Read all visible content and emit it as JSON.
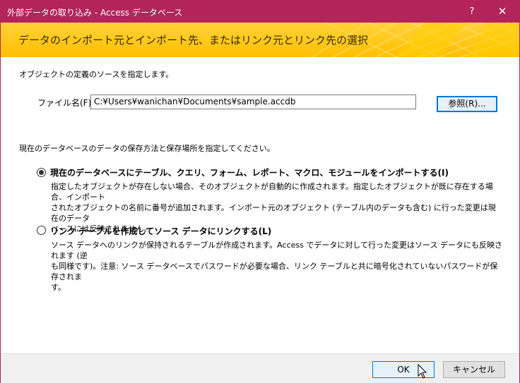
{
  "window": {
    "title": "外部データの取り込み - Access データベース",
    "help_label": "?",
    "close_label": "✕",
    "accent_color": "#b3245b"
  },
  "banner": {
    "heading": "データのインポート元とインポート先、またはリンク元とリンク先の選択",
    "color": "#ffc000"
  },
  "source": {
    "description": "オブジェクトの定義のソースを指定します。",
    "file_label": "ファイル名(F):",
    "file_value": "C:¥Users¥wanichan¥Documents¥sample.accdb",
    "browse_label": "参照(R)..."
  },
  "storage": {
    "description": "現在のデータベースのデータの保存方法と保存場所を指定してください。",
    "options": [
      {
        "label": "現在のデータベースにテーブル、クエリ、フォーム、レポート、マクロ、モジュールをインポートする(I)",
        "selected": true,
        "description_lines": [
          "指定したオブジェクトが存在しない場合、そのオブジェクトが自動的に作成されます。指定したオブジェクトが既に存在する場合、インポート",
          "されたオブジェクトの名前に番号が追加されます。インポート元のオブジェクト (テーブル内のデータも含む) に行った変更は現在のデータ",
          "ベースには反映されません。"
        ]
      },
      {
        "label": "リンク テーブルを作成してソース データにリンクする(L)",
        "selected": false,
        "description_lines": [
          "ソース データへのリンクが保持されるテーブルが作成されます。Access でデータに対して行った変更はソース データにも反映されます (逆",
          "も同様です)。注意: ソース データベースでパスワードが必要な場合、リンク テーブルと共に暗号化されていないパスワードが保存されま",
          "す。"
        ]
      }
    ]
  },
  "footer": {
    "ok_label": "OK",
    "cancel_label": "キャンセル"
  }
}
